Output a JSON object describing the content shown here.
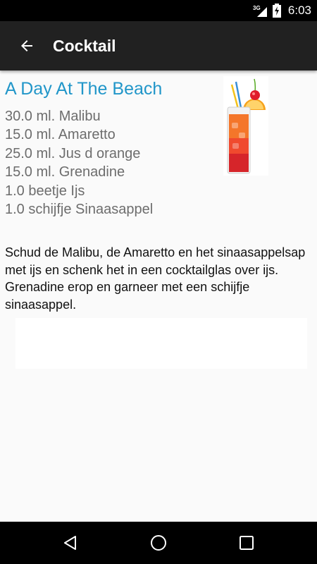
{
  "status_bar": {
    "network": "3G",
    "time": "6:03"
  },
  "app_bar": {
    "title": "Cocktail",
    "back_icon": "arrow-left-icon"
  },
  "recipe": {
    "name": "A Day At The Beach",
    "ingredients": [
      "30.0 ml. Malibu",
      "15.0 ml. Amaretto",
      "25.0 ml. Jus d orange",
      "15.0 ml. Grenadine",
      "1.0 beetje Ijs",
      "1.0 schijfje Sinaasappel"
    ],
    "instructions": "Schud de Malibu, de Amaretto en het sinaasappelsap met ijs en schenk het in een cocktailglas over ijs. Grenadine erop en garneer met een schijfje sinaasappel."
  },
  "colors": {
    "accent": "#2196c9",
    "app_bar": "#212121",
    "ingredient_text": "#6d6d6d"
  },
  "nav_bar": {
    "back": "nav-back-icon",
    "home": "nav-home-icon",
    "recents": "nav-recents-icon"
  }
}
